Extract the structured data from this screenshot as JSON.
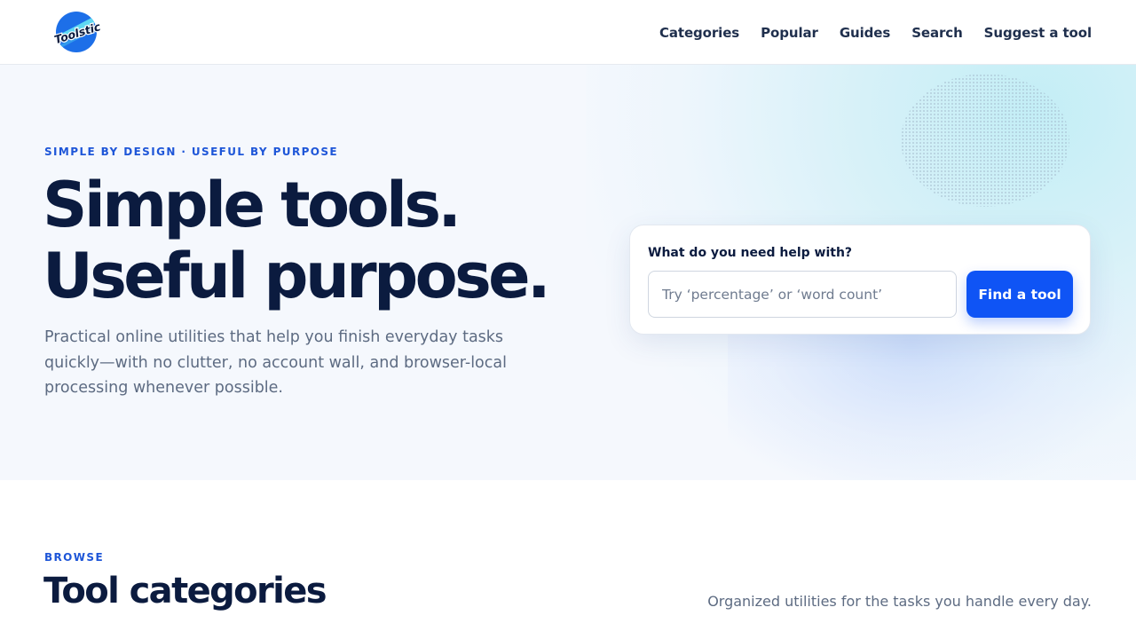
{
  "header": {
    "logo_text": "Toolstic",
    "nav": [
      "Categories",
      "Popular",
      "Guides",
      "Search",
      "Suggest a tool"
    ]
  },
  "hero": {
    "eyebrow": "SIMPLE BY DESIGN · USEFUL BY PURPOSE",
    "title_line1": "Simple tools.",
    "title_line2": "Useful purpose.",
    "subtitle": "Practical online utilities that help you finish everyday tasks quickly—with no clutter, no account wall, and browser-local processing whenever possible."
  },
  "search": {
    "label": "What do you need help with?",
    "placeholder": "Try ‘percentage’ or ‘word count’",
    "value": "",
    "button_label": "Find a tool"
  },
  "categories_section": {
    "eyebrow": "BROWSE",
    "title": "Tool categories",
    "description": "Organized utilities for the tasks you handle every day."
  },
  "colors": {
    "accent": "#0f54f5",
    "eyebrow": "#1e56d8",
    "heading": "#0b1b3f",
    "body_text": "#5d6b82"
  },
  "icons": [
    "toolstic-logo-icon"
  ]
}
